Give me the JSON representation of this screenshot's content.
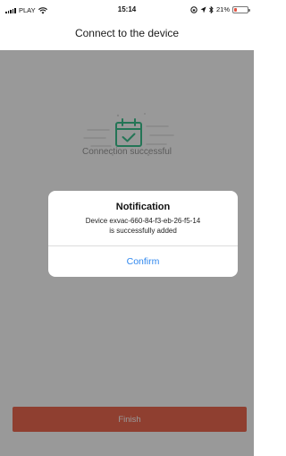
{
  "status_bar": {
    "carrier": "PLAY",
    "time": "15:14",
    "battery_text": "21%",
    "battery_level": 0.21
  },
  "header": {
    "title": "Connect to the device"
  },
  "main": {
    "status_text": "Connection successful"
  },
  "dialog": {
    "title": "Notification",
    "message_line1": "Device exvac-660-84-f3-eb-26-f5-14",
    "message_line2": "is successfully added",
    "confirm_label": "Confirm"
  },
  "footer": {
    "finish_label": "Finish"
  },
  "colors": {
    "accent": "#ee6950",
    "link": "#2f87ee",
    "icon": "#3cc48f",
    "battery_low": "#e25444"
  }
}
